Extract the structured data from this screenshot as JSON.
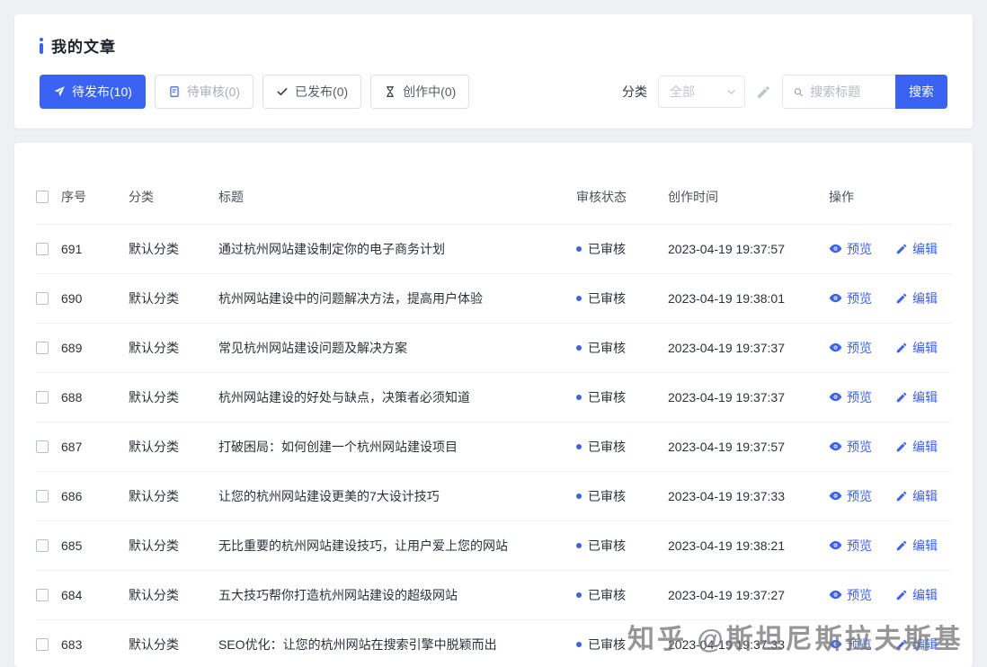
{
  "colors": {
    "primary": "#3a62f3",
    "page_bg": "#eef0f4",
    "link": "#3a62f3",
    "status_dot": "#3a62f3"
  },
  "header": {
    "title": "我的文章"
  },
  "tabs": [
    {
      "label": "待发布(10)",
      "icon": "send-icon",
      "active": true
    },
    {
      "label": "待审核(0)",
      "icon": "audit-doc-icon",
      "active": false
    },
    {
      "label": "已发布(0)",
      "icon": "check-icon",
      "active": false
    },
    {
      "label": "创作中(0)",
      "icon": "hourglass-icon",
      "active": false
    }
  ],
  "filter": {
    "category_label": "分类",
    "category_value": "全部",
    "search_placeholder": "搜索标题",
    "search_button_label": "搜索"
  },
  "table": {
    "headers": [
      "序号",
      "分类",
      "标题",
      "审核状态",
      "创作时间",
      "操作"
    ],
    "actions": {
      "preview": "预览",
      "edit": "编辑"
    },
    "rows": [
      {
        "id": "691",
        "category": "默认分类",
        "title": "通过杭州网站建设制定你的电子商务计划",
        "status": "已审核",
        "time": "2023-04-19 19:37:57"
      },
      {
        "id": "690",
        "category": "默认分类",
        "title": "杭州网站建设中的问题解决方法，提高用户体验",
        "status": "已审核",
        "time": "2023-04-19 19:38:01"
      },
      {
        "id": "689",
        "category": "默认分类",
        "title": "常见杭州网站建设问题及解决方案",
        "status": "已审核",
        "time": "2023-04-19 19:37:37"
      },
      {
        "id": "688",
        "category": "默认分类",
        "title": "杭州网站建设的好处与缺点，决策者必须知道",
        "status": "已审核",
        "time": "2023-04-19 19:37:37"
      },
      {
        "id": "687",
        "category": "默认分类",
        "title": "打破困局：如何创建一个杭州网站建设项目",
        "status": "已审核",
        "time": "2023-04-19 19:37:57"
      },
      {
        "id": "686",
        "category": "默认分类",
        "title": "让您的杭州网站建设更美的7大设计技巧",
        "status": "已审核",
        "time": "2023-04-19 19:37:33"
      },
      {
        "id": "685",
        "category": "默认分类",
        "title": "无比重要的杭州网站建设技巧，让用户爱上您的网站",
        "status": "已审核",
        "time": "2023-04-19 19:38:21"
      },
      {
        "id": "684",
        "category": "默认分类",
        "title": "五大技巧帮你打造杭州网站建设的超级网站",
        "status": "已审核",
        "time": "2023-04-19 19:37:27"
      },
      {
        "id": "683",
        "category": "默认分类",
        "title": "SEO优化：让您的杭州网站在搜索引擎中脱颖而出",
        "status": "已审核",
        "time": "2023-04-19 19:37:33"
      }
    ]
  },
  "watermark": "知乎 @斯坦尼斯拉夫斯基"
}
